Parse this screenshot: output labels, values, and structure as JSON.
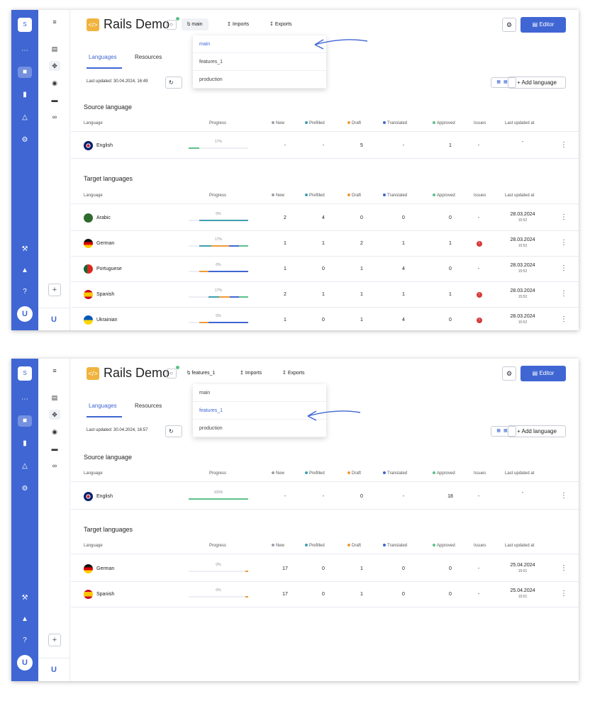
{
  "colors": {
    "brand": "#3f66d3",
    "approved": "#5cc18a",
    "prefilled": "#3f9fb0",
    "draft": "#ef9a35",
    "translated": "#3f66d3",
    "new": "#9aa0ab",
    "issue": "#d63a3a"
  },
  "workspace_initial": "S",
  "project": {
    "title": "Rails Demo",
    "imports": "Imports",
    "exports": "Exports",
    "editor": "Editor"
  },
  "tabs": {
    "languages": "Languages",
    "resources": "Resources"
  },
  "add_language": "+ Add language",
  "columns": {
    "language": "Language",
    "progress": "Progress",
    "new": "New",
    "prefilled": "Prefilled",
    "draft": "Draft",
    "translated": "Translated",
    "approved": "Approved",
    "issues": "Issues",
    "last_updated": "Last updated at"
  },
  "top": {
    "branch": "main",
    "updated": "Last updated: 30.04.2024, 16:49",
    "source_title": "Source language",
    "target_title": "Target languages",
    "dropdown": [
      "main",
      "features_1",
      "production"
    ],
    "selected": 0,
    "source": [
      {
        "name": "English",
        "progress": "17%",
        "new": "-",
        "prefilled": "-",
        "draft": "5",
        "translated": "-",
        "approved": "1",
        "issues": "-",
        "date": "-",
        "time": ""
      }
    ],
    "targets": [
      {
        "name": "Arabic",
        "progress": "0%",
        "new": "2",
        "prefilled": "4",
        "draft": "0",
        "translated": "0",
        "approved": "0",
        "issues": "-",
        "date": "28.03.2024",
        "time": "15:52"
      },
      {
        "name": "German",
        "progress": "17%",
        "new": "1",
        "prefilled": "1",
        "draft": "2",
        "translated": "1",
        "approved": "1",
        "issues": "!",
        "date": "28.03.2024",
        "time": "15:52"
      },
      {
        "name": "Portuguese",
        "progress": "0%",
        "new": "1",
        "prefilled": "0",
        "draft": "1",
        "translated": "4",
        "approved": "0",
        "issues": "-",
        "date": "28.03.2024",
        "time": "15:52"
      },
      {
        "name": "Spanish",
        "progress": "17%",
        "new": "2",
        "prefilled": "1",
        "draft": "1",
        "translated": "1",
        "approved": "1",
        "issues": "!",
        "date": "28.03.2024",
        "time": "15:52"
      },
      {
        "name": "Ukrainian",
        "progress": "0%",
        "new": "1",
        "prefilled": "0",
        "draft": "1",
        "translated": "4",
        "approved": "0",
        "issues": "!",
        "date": "28.03.2024",
        "time": "15:52"
      }
    ]
  },
  "bottom": {
    "branch": "features_1",
    "updated": "Last updated: 30.04.2024, 16:57",
    "source_title": "Source language",
    "target_title": "Target languages",
    "dropdown": [
      "main",
      "features_1",
      "production"
    ],
    "selected": 1,
    "source": [
      {
        "name": "English",
        "progress": "100%",
        "new": "-",
        "prefilled": "-",
        "draft": "0",
        "translated": "-",
        "approved": "18",
        "issues": "-",
        "date": "-",
        "time": ""
      }
    ],
    "targets": [
      {
        "name": "German",
        "progress": "0%",
        "new": "17",
        "prefilled": "0",
        "draft": "1",
        "translated": "0",
        "approved": "0",
        "issues": "-",
        "date": "25.04.2024",
        "time": "15:01"
      },
      {
        "name": "Spanish",
        "progress": "0%",
        "new": "17",
        "prefilled": "0",
        "draft": "1",
        "translated": "0",
        "approved": "0",
        "issues": "-",
        "date": "25.04.2024",
        "time": "15:01"
      }
    ]
  }
}
